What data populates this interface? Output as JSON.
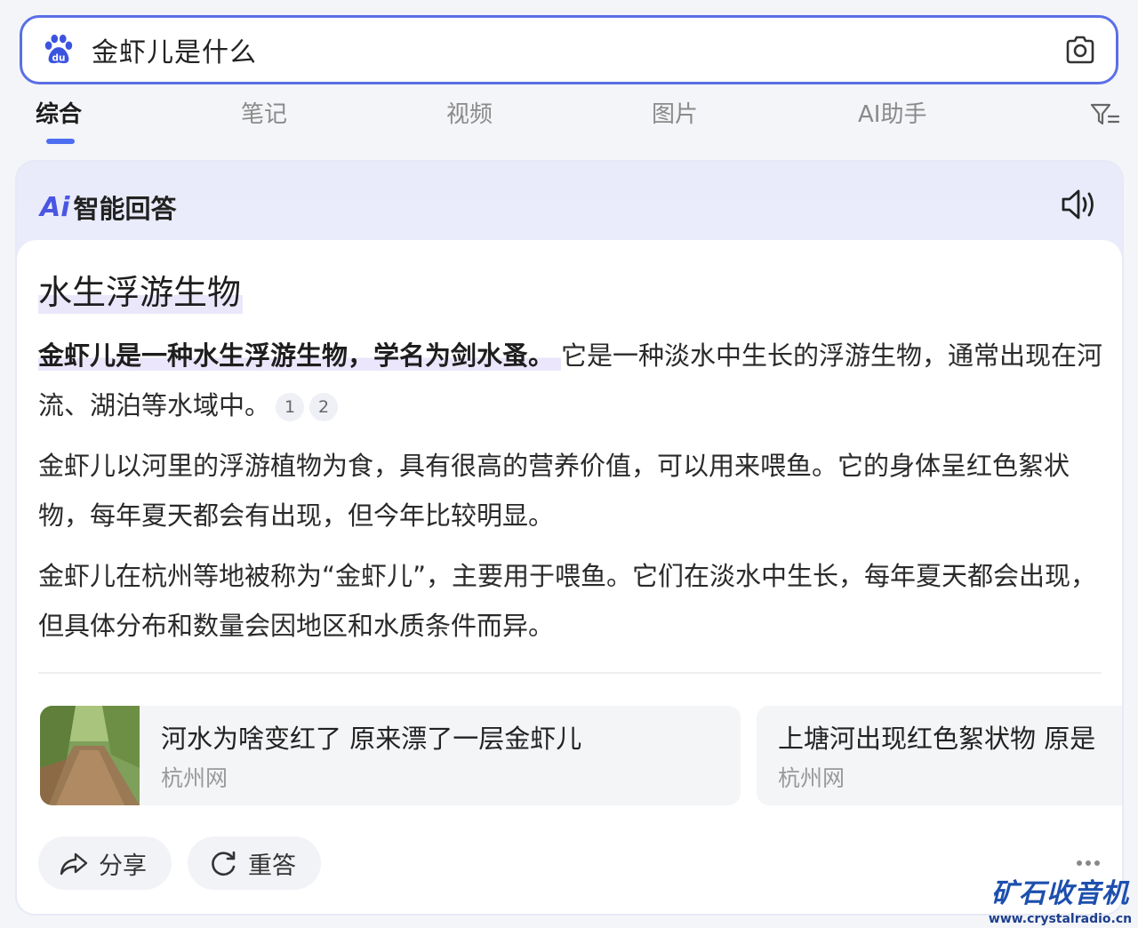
{
  "search": {
    "query": "金虾儿是什么"
  },
  "tabs": [
    {
      "label": "综合",
      "active": true
    },
    {
      "label": "笔记"
    },
    {
      "label": "视频"
    },
    {
      "label": "图片"
    },
    {
      "label": "AI助手"
    }
  ],
  "ai_answer": {
    "mark": "Ai",
    "title": "智能回答",
    "headline": "水生浮游生物",
    "p1_highlight": "金虾儿是一种水生浮游生物，学名为剑水蚤。",
    "p1_rest": "它是一种淡水中生长的浮游生物，通常出现在河流、湖泊等水域中。",
    "citations": [
      "1",
      "2"
    ],
    "p2": "金虾儿以河里的浮游植物为食，具有很高的营养价值，可以用来喂鱼。它的身体呈红色絮状物，每年夏天都会有出现，但今年比较明显。",
    "p3": "金虾儿在杭州等地被称为“金虾儿”，主要用于喂鱼。它们在淡水中生长，每年夏天都会出现，但具体分布和数量会因地区和水质条件而异。"
  },
  "sources": [
    {
      "title": "河水为啥变红了 原来漂了一层金虾儿",
      "site": "杭州网"
    },
    {
      "title": "上塘河出现红色絮状物 原是",
      "site": "杭州网"
    }
  ],
  "actions": {
    "share": "分享",
    "regenerate": "重答"
  },
  "watermark": {
    "name": "矿石收音机",
    "url": "www.crystalradio.cn"
  },
  "colors": {
    "accent": "#4e6ef2",
    "search_border": "#5b6fe6",
    "highlight": "#ebe6fb"
  }
}
